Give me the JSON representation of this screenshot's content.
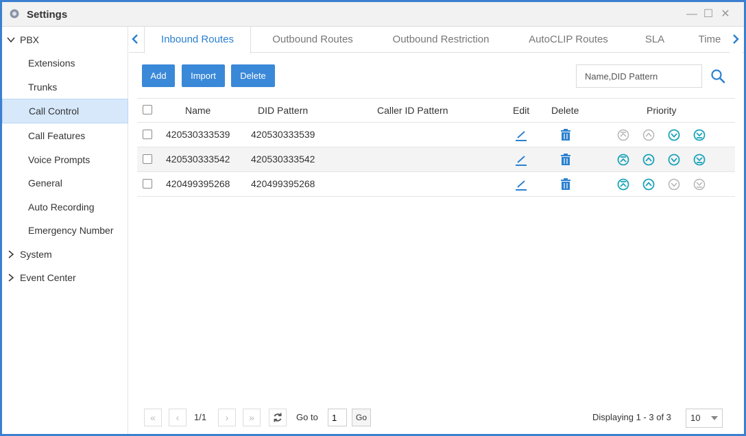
{
  "window": {
    "title": "Settings",
    "minimize_glyph": "—",
    "maximize_glyph": "☐",
    "close_glyph": "✕"
  },
  "sidebar": {
    "groups": [
      {
        "label": "PBX",
        "expanded": true
      },
      {
        "label": "System",
        "expanded": false
      },
      {
        "label": "Event Center",
        "expanded": false
      }
    ],
    "items": [
      {
        "label": "Extensions"
      },
      {
        "label": "Trunks"
      },
      {
        "label": "Call Control",
        "active": true
      },
      {
        "label": "Call Features"
      },
      {
        "label": "Voice Prompts"
      },
      {
        "label": "General"
      },
      {
        "label": "Auto Recording"
      },
      {
        "label": "Emergency Number"
      }
    ]
  },
  "tabs": [
    {
      "label": "Inbound Routes",
      "active": true
    },
    {
      "label": "Outbound Routes"
    },
    {
      "label": "Outbound Restriction"
    },
    {
      "label": "AutoCLIP Routes"
    },
    {
      "label": "SLA"
    },
    {
      "label": "Time"
    }
  ],
  "toolbar": {
    "add_label": "Add",
    "import_label": "Import",
    "delete_label": "Delete",
    "search_placeholder": "Name,DID Pattern"
  },
  "table": {
    "headers": {
      "name": "Name",
      "did": "DID Pattern",
      "caller_id": "Caller ID Pattern",
      "edit": "Edit",
      "delete": "Delete",
      "priority": "Priority"
    },
    "rows": [
      {
        "name": "420530333539",
        "did": "420530333539",
        "caller_id": "",
        "priority_enabled": [
          false,
          false,
          true,
          true
        ]
      },
      {
        "name": "420530333542",
        "did": "420530333542",
        "caller_id": "",
        "priority_enabled": [
          true,
          true,
          true,
          true
        ]
      },
      {
        "name": "420499395268",
        "did": "420499395268",
        "caller_id": "",
        "priority_enabled": [
          true,
          true,
          false,
          false
        ]
      }
    ]
  },
  "pager": {
    "first_glyph": "«",
    "prev_glyph": "‹",
    "next_glyph": "›",
    "last_glyph": "»",
    "page_info": "1/1",
    "goto_label": "Go to",
    "goto_value": "1",
    "go_label": "Go",
    "displaying": "Displaying 1 - 3 of 3",
    "page_size": "10"
  },
  "colors": {
    "accent": "#3a88d8",
    "icon_active": "#1aa3b8",
    "icon_inactive": "#b5b5b5",
    "frame": "#3c7fd0"
  }
}
